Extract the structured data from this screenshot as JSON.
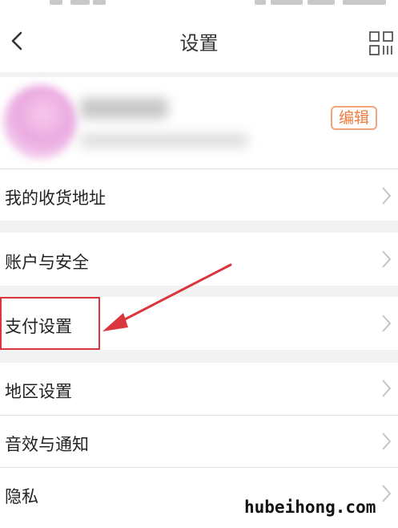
{
  "header": {
    "title": "设置"
  },
  "icons": {
    "back": "chevron-left-icon",
    "qr": "qr-code-icon",
    "row_arrow": "chevron-right-icon"
  },
  "profile": {
    "edit_label": "编辑"
  },
  "menu": {
    "items": [
      {
        "label": "我的收货地址"
      },
      {
        "label": "账户与安全"
      },
      {
        "label": "支付设置"
      },
      {
        "label": "地区设置"
      },
      {
        "label": "音效与通知"
      },
      {
        "label": "隐私"
      }
    ]
  },
  "colors": {
    "accent": "#ef7a3d",
    "annotation": "#d9363e",
    "background": "#f2f2f2"
  },
  "watermark": "hubeihong.com"
}
